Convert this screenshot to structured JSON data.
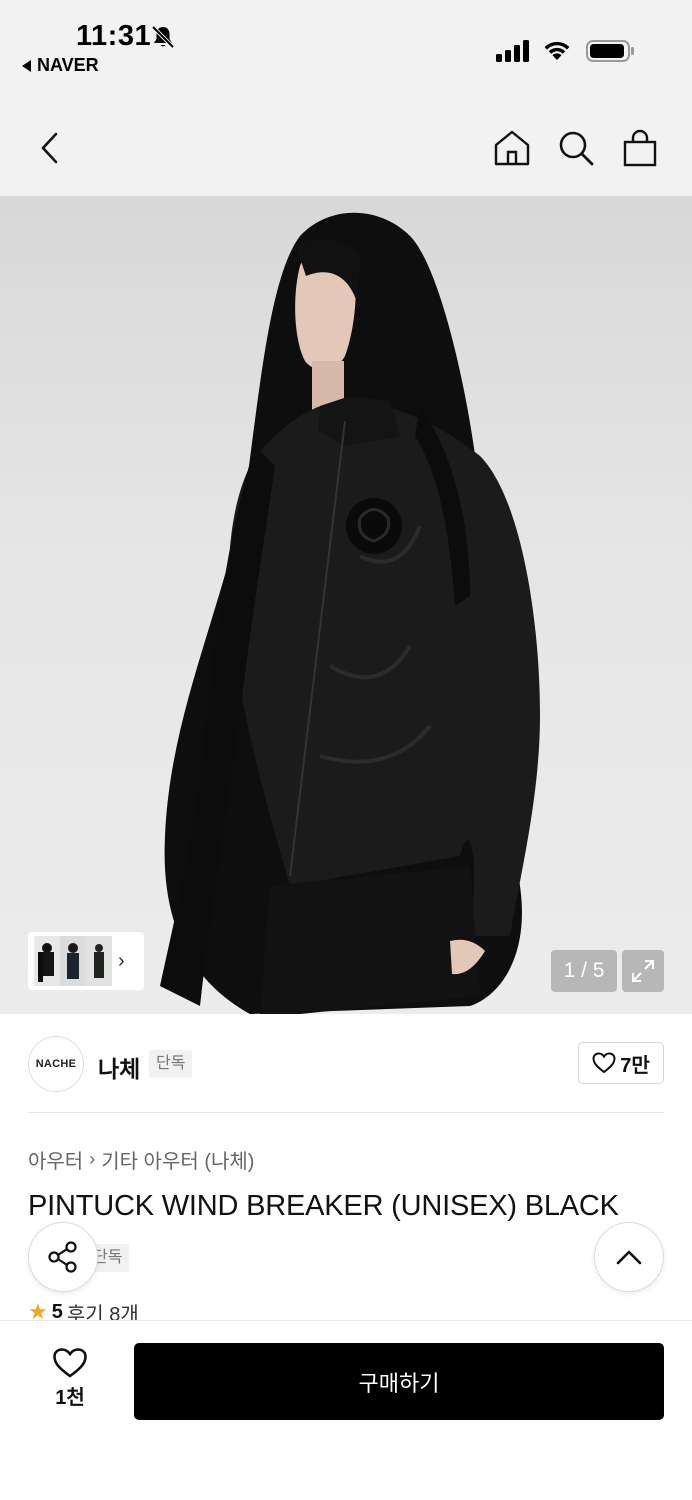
{
  "status_bar": {
    "time": "11:31",
    "back_app": "NAVER"
  },
  "nav": {
    "icons": [
      "back-arrow-icon",
      "home-icon",
      "search-icon",
      "shopping-bag-icon"
    ]
  },
  "gallery": {
    "counter": "1 / 5",
    "current_index": 1,
    "total": 5
  },
  "brand": {
    "logo_text": "NACHE",
    "name": "나체",
    "tag": "단독",
    "like_count": "7만"
  },
  "product": {
    "breadcrumb": [
      "아우터",
      "기타 아우터 (나체)"
    ],
    "title": "PINTUCK WIND BREAKER (UNISEX) BLACK",
    "tag": "단독",
    "rating": "5",
    "reviews": "후기 8개"
  },
  "bottom_bar": {
    "wish_count": "1천",
    "buy_label": "구매하기"
  },
  "colors": {
    "accent_star": "#f5a623",
    "buy_button": "#000000",
    "header_bg": "#f2f2f2"
  }
}
